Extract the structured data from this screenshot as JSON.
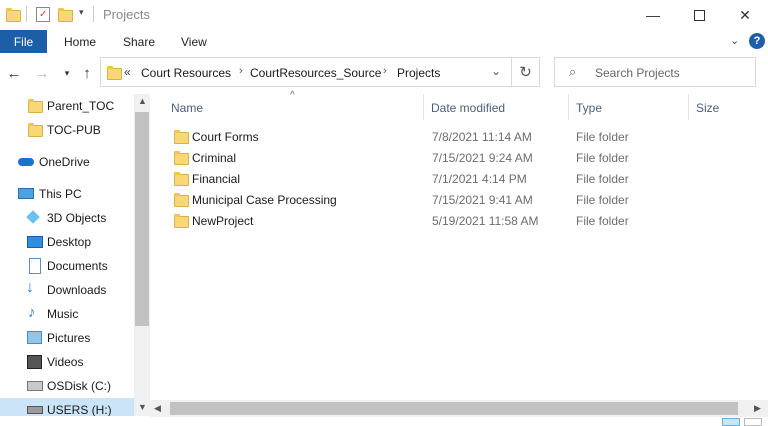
{
  "title": "Projects",
  "ribbon": {
    "file": "File",
    "home": "Home",
    "share": "Share",
    "view": "View"
  },
  "address": {
    "overflow": "«",
    "crumbs": [
      "Court Resources",
      "CourtResources_Source",
      "Projects"
    ]
  },
  "search": {
    "placeholder": "Search Projects"
  },
  "nav": {
    "items": [
      {
        "label": "Parent_TOC",
        "icon": "folder-icon"
      },
      {
        "label": "TOC-PUB",
        "icon": "folder-icon"
      },
      {
        "label": "OneDrive",
        "icon": "cloud-icon"
      },
      {
        "label": "This PC",
        "icon": "computer-icon"
      },
      {
        "label": "3D Objects",
        "icon": "cube-icon"
      },
      {
        "label": "Desktop",
        "icon": "desktop-icon"
      },
      {
        "label": "Documents",
        "icon": "documents-icon"
      },
      {
        "label": "Downloads",
        "icon": "download-icon"
      },
      {
        "label": "Music",
        "icon": "music-icon"
      },
      {
        "label": "Pictures",
        "icon": "pictures-icon"
      },
      {
        "label": "Videos",
        "icon": "videos-icon"
      },
      {
        "label": "OSDisk (C:)",
        "icon": "disk-icon"
      },
      {
        "label": "USERS (H:)",
        "icon": "network-drive-icon"
      }
    ]
  },
  "columns": {
    "name": "Name",
    "date": "Date modified",
    "type": "Type",
    "size": "Size"
  },
  "files": [
    {
      "name": "Court Forms",
      "date": "7/8/2021 11:14 AM",
      "type": "File folder"
    },
    {
      "name": "Criminal",
      "date": "7/15/2021 9:24 AM",
      "type": "File folder"
    },
    {
      "name": "Financial",
      "date": "7/1/2021 4:14 PM",
      "type": "File folder"
    },
    {
      "name": "Municipal Case Processing",
      "date": "7/15/2021 9:41 AM",
      "type": "File folder"
    },
    {
      "name": "NewProject",
      "date": "5/19/2021 11:58 AM",
      "type": "File folder"
    }
  ],
  "colors": {
    "file_tab": "#1c5fa8",
    "folder": "#f8d775",
    "header_text": "#4c607a"
  }
}
